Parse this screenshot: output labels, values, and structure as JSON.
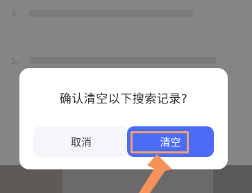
{
  "dialog": {
    "title": "确认清空以下搜索记录?",
    "cancel_label": "取消",
    "confirm_label": "清空"
  },
  "background": {
    "row1_number": "4、",
    "row2_number": "5、"
  },
  "colors": {
    "accent": "#4a6cf7",
    "highlight": "#f0a06a",
    "overlay": "#858585"
  }
}
